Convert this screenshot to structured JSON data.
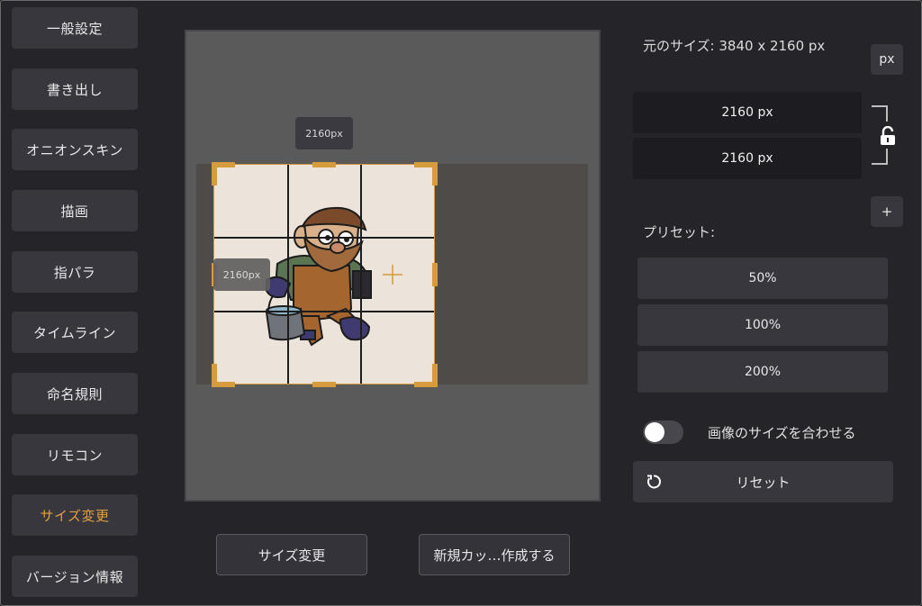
{
  "sidebar": {
    "items": [
      {
        "label": "一般設定",
        "active": false
      },
      {
        "label": "書き出し",
        "active": false
      },
      {
        "label": "オニオンスキン",
        "active": false
      },
      {
        "label": "描画",
        "active": false
      },
      {
        "label": "指パラ",
        "active": false
      },
      {
        "label": "タイムライン",
        "active": false
      },
      {
        "label": "命名規則",
        "active": false
      },
      {
        "label": "リモコン",
        "active": false
      },
      {
        "label": "サイズ変更",
        "active": true
      },
      {
        "label": "バージョン情報",
        "active": false
      }
    ]
  },
  "canvas": {
    "width_tag": "2160px",
    "height_tag": "2160px"
  },
  "actions": {
    "resize_label": "サイズ変更",
    "new_cut_label": "新規カッ…作成する"
  },
  "settings": {
    "original_size": "元のサイズ: 3840 x 2160 px",
    "unit": "px",
    "width_value": "2160 px",
    "height_value": "2160 px",
    "add_label": "+",
    "presets_label": "プリセット:",
    "presets": [
      "50%",
      "100%",
      "200%"
    ],
    "fit_image_label": "画像のサイズを合わせる",
    "fit_image_enabled": false,
    "reset_label": "リセット"
  },
  "colors": {
    "accent": "#e2a23c",
    "background": "#252429",
    "button": "#38373e",
    "field": "#1d1c21"
  }
}
